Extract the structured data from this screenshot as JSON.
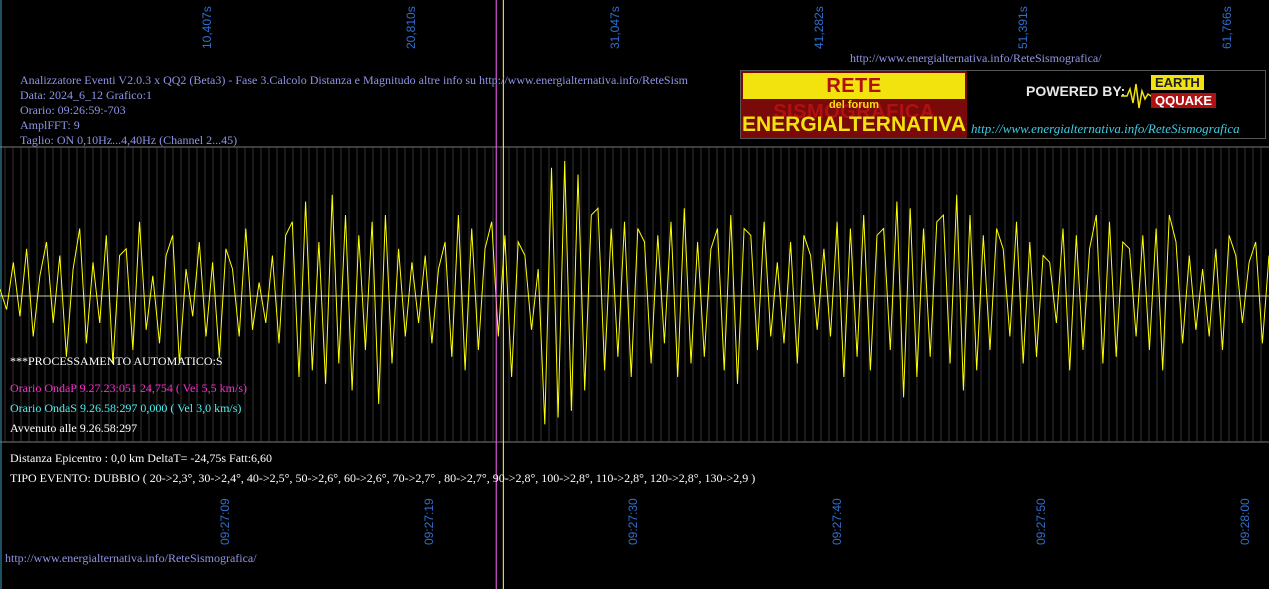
{
  "header": {
    "top_url": "http://www.energialternativa.info/ReteSismografica/",
    "title_line": "Analizzatore Eventi V2.0.3 x QQ2 (Beta3) - Fase 3.Calcolo Distanza e Magnitudo altre info su http://www.energialternativa.info/ReteSism",
    "data_line": "Data: 2024_6_12 Grafico:1",
    "orario_line": "Orario: 09:26:59:-703",
    "ampl_line": "AmplFFT: 9",
    "taglio_line": "Taglio: ON 0,10Hz...4,40Hz      (Channel 2...45)"
  },
  "logo": {
    "rete": "RETE SISMOGRAFICA",
    "forum": "del forum",
    "energ": "ENERGIALTERNATIVA",
    "powered": "POWERED BY:",
    "earth": "EARTH",
    "qquake": "QQUAKE",
    "url": "http://www.energialternativa.info/ReteSismografica"
  },
  "processing": {
    "header": "***PROCESSAMENTO AUTOMATICO:S",
    "onda_p": "Orario OndaP 9.27.23:051  24,754 ( Vel 5,5 km/s)",
    "onda_s": "Orario OndaS 9.26.58:297  0,000 ( Vel 3,0 km/s)",
    "avvenuto": "Avvenuto alle 9.26.58:297",
    "distanza": "Distanza Epicentro : 0,0 km DeltaT= -24,75s  Fatt:6,60",
    "tipo": "TIPO EVENTO: DUBBIO ( 20->2,3°, 30->2,4°, 40->2,5°, 50->2,6°, 60->2,6°, 70->2,7° , 80->2,7°, 90->2,8°, 100->2,8°, 110->2,8°, 120->2,8°, 130->2,9 )"
  },
  "footer_url": "http://www.energialternativa.info/ReteSismografica/",
  "colors": {
    "trace": "#ffff00",
    "baseline": "#c8c8a0",
    "marker_p": "#ff66ff",
    "marker_s": "#ffff66",
    "grid": "#555555",
    "axis_labels": "#2f6fd0"
  },
  "chart_data": {
    "type": "line",
    "top_axis_ticks": [
      "10,407s",
      "20,810s",
      "31,047s",
      "41,282s",
      "51,391s",
      "61,766s"
    ],
    "bottom_axis_ticks": [
      "09:27:09",
      "09:27:19",
      "09:27:30",
      "09:27:40",
      "09:27:50",
      "09:28:00"
    ],
    "x_range_s": [
      0,
      62.4
    ],
    "p_marker_s": 24.4,
    "s_marker_s": 24.75,
    "series": [
      {
        "values": [
          0.05,
          -0.1,
          0.25,
          -0.15,
          0.35,
          -0.3,
          0.15,
          0.4,
          -0.2,
          0.3,
          -0.45,
          0.2,
          0.5,
          -0.35,
          0.25,
          -0.2,
          0.45,
          -0.5,
          0.3,
          0.35,
          -0.4,
          0.55,
          -0.25,
          0.15,
          -0.35,
          0.3,
          0.45,
          -0.5,
          0.2,
          -0.15,
          0.4,
          -0.3,
          0.25,
          -0.45,
          0.35,
          0.2,
          -0.3,
          0.5,
          -0.25,
          0.1,
          -0.2,
          0.3,
          -0.35,
          0.45,
          0.55,
          -0.6,
          0.7,
          -0.55,
          0.4,
          -0.65,
          0.75,
          -0.5,
          0.6,
          -0.7,
          0.45,
          -0.4,
          0.55,
          -0.8,
          0.6,
          -0.5,
          0.35,
          -0.3,
          0.25,
          -0.2,
          0.3,
          -0.35,
          0.2,
          0.4,
          -0.45,
          0.6,
          -0.55,
          0.5,
          -0.4,
          0.35,
          0.55,
          -0.3,
          0.45,
          -0.6,
          0.4,
          0.3,
          -0.25,
          0.2,
          -0.95,
          0.95,
          -0.9,
          1.0,
          -0.85,
          0.9,
          -0.7,
          0.6,
          0.65,
          -0.55,
          0.5,
          -0.45,
          0.55,
          -0.6,
          0.5,
          0.4,
          -0.5,
          0.45,
          -0.35,
          0.55,
          -0.6,
          0.65,
          -0.5,
          0.4,
          -0.45,
          0.35,
          0.5,
          -0.55,
          0.6,
          -0.65,
          0.5,
          0.45,
          -0.4,
          0.55,
          -0.3,
          0.25,
          -0.35,
          0.4,
          -0.5,
          0.45,
          0.3,
          -0.25,
          0.35,
          -0.3,
          0.55,
          -0.6,
          0.5,
          -0.45,
          0.6,
          -0.55,
          0.45,
          0.5,
          -0.4,
          0.7,
          -0.75,
          0.65,
          -0.6,
          0.5,
          -0.45,
          0.55,
          0.6,
          -0.5,
          0.75,
          -0.7,
          0.6,
          -0.55,
          0.45,
          -0.4,
          0.5,
          0.35,
          -0.3,
          0.55,
          -0.5,
          0.4,
          -0.45,
          0.3,
          0.25,
          -0.2,
          0.5,
          -0.55,
          0.45,
          -0.4,
          0.35,
          0.6,
          -0.5,
          0.55,
          -0.45,
          0.4,
          0.35,
          -0.3,
          0.45,
          -0.4,
          0.5,
          -0.55,
          0.6,
          0.4,
          -0.35,
          0.3,
          -0.25,
          0.2,
          -0.3,
          0.35,
          -0.4,
          0.45,
          0.3,
          -0.2,
          0.25,
          0.4,
          -0.35,
          0.3
        ]
      }
    ]
  }
}
